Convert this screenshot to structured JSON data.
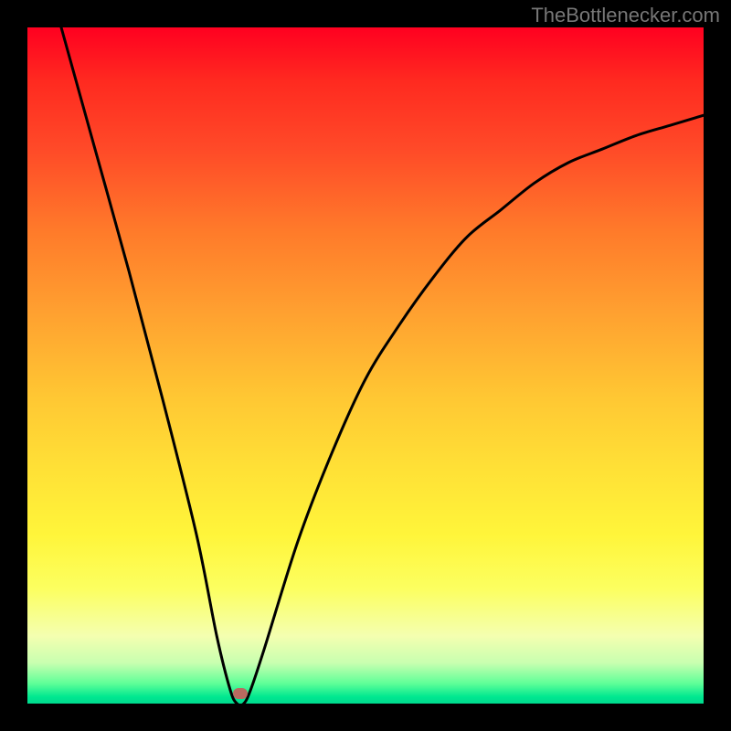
{
  "watermark": "TheBottlenecker.com",
  "chart_data": {
    "type": "line",
    "title": "",
    "xlabel": "",
    "ylabel": "",
    "xlim": [
      0,
      100
    ],
    "ylim": [
      0,
      100
    ],
    "series": [
      {
        "name": "bottleneck-curve",
        "x": [
          5,
          10,
          15,
          20,
          25,
          28,
          30,
          31,
          32,
          33,
          35,
          40,
          45,
          50,
          55,
          60,
          65,
          70,
          75,
          80,
          85,
          90,
          95,
          100
        ],
        "values": [
          100,
          82,
          64,
          45,
          25,
          10,
          2,
          0,
          0,
          2,
          8,
          24,
          37,
          48,
          56,
          63,
          69,
          73,
          77,
          80,
          82,
          84,
          85.5,
          87
        ]
      }
    ],
    "marker": {
      "x": 31.5,
      "y": 1.5
    },
    "gradient_stops": [
      {
        "pct": 0,
        "color": "#ff0020"
      },
      {
        "pct": 50,
        "color": "#ffc833"
      },
      {
        "pct": 80,
        "color": "#fff53a"
      },
      {
        "pct": 100,
        "color": "#00da8e"
      }
    ]
  }
}
